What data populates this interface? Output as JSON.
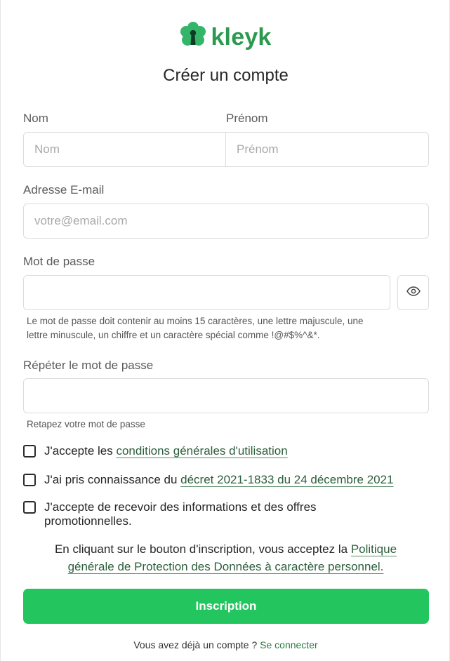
{
  "brand": {
    "name": "kleyk",
    "color": "#2c9a4e",
    "logo_icon": "keyhole-flower-icon"
  },
  "page_title": "Créer un compte",
  "form": {
    "last_name": {
      "label": "Nom",
      "placeholder": "Nom",
      "value": ""
    },
    "first_name": {
      "label": "Prénom",
      "placeholder": "Prénom",
      "value": ""
    },
    "email": {
      "label": "Adresse E-mail",
      "placeholder": "votre@email.com",
      "value": ""
    },
    "password": {
      "label": "Mot de passe",
      "placeholder": "",
      "value": "",
      "toggle_icon": "eye-icon",
      "hint_line1": "Le mot de passe doit contenir au moins 15 caractères, une lettre majuscule, une",
      "hint_line2": "lettre minuscule, un chiffre et un caractère spécial comme !@#$%^&*."
    },
    "password_repeat": {
      "label": "Répéter le mot de passe",
      "placeholder": "",
      "value": "",
      "hint": "Retapez votre mot de passe"
    }
  },
  "checkboxes": {
    "terms": {
      "text": "J'accepte les ",
      "link": "conditions générales d'utilisation",
      "checked": false
    },
    "decree": {
      "text": "J'ai pris connaissance du ",
      "link": "décret 2021-1833 du 24 décembre 2021",
      "checked": false
    },
    "marketing": {
      "text_line1": "J'accepte de recevoir des informations et des offres",
      "text_line2": "promotionnelles.",
      "checked": false
    }
  },
  "consent": {
    "text": "En cliquant sur le bouton d'inscription, vous acceptez la ",
    "link_part1": "Politique",
    "link_part2": "générale de Protection des Données à caractère personnel."
  },
  "submit_label": "Inscription",
  "submit_color": "#22c55e",
  "footer": {
    "text": "Vous avez déjà un compte ? ",
    "link": "Se connecter"
  }
}
